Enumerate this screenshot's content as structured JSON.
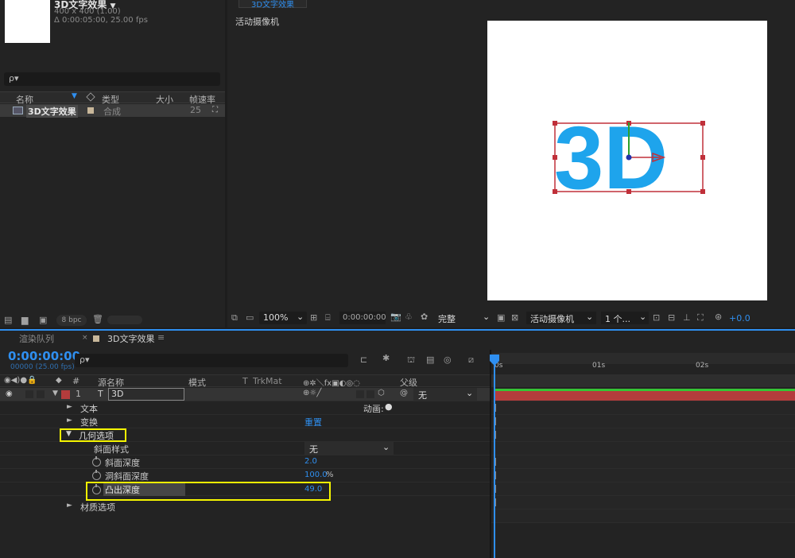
{
  "project": {
    "comp_name": "3D文字效果",
    "comp_size": "400 x 400 (1.00)",
    "comp_duration": "Δ 0:00:05:00, 25.00 fps",
    "search_placeholder": "ρ▾",
    "columns": {
      "name": "名称",
      "type": "类型",
      "size": "大小",
      "fps": "帧速率"
    },
    "items": [
      {
        "name": "3D文字效果",
        "type": "合成",
        "fps": "25"
      }
    ],
    "bpc": "8 bpc"
  },
  "viewer": {
    "tab": "3D文字效果",
    "camera_label": "活动摄像机",
    "zoom": "100%",
    "timecode": "0:00:00:00",
    "resolution": "完整",
    "view_camera": "活动摄像机",
    "views": "1 个...",
    "exposure": "+0.0",
    "text_3d": "3D"
  },
  "timeline": {
    "tabs": {
      "render": "渲染队列",
      "comp": "3D文字效果"
    },
    "timecode": "0:00:00:00",
    "frame_info": "00000 (25.00 fps)",
    "search_placeholder": "ρ▾",
    "headers": {
      "num": "#",
      "source": "源名称",
      "mode": "模式",
      "t": "T",
      "trkmat": "TrkMat",
      "parent": "父级"
    },
    "layer": {
      "index": "1",
      "type": "T",
      "name": "3D",
      "parent": "无"
    },
    "animate_label": "动画:",
    "props": {
      "text": "文本",
      "transform": "变换",
      "reset": "重置",
      "geometry": "几何选项",
      "bevel_style": "斜面样式",
      "bevel_style_value": "无",
      "bevel_depth": "斜面深度",
      "bevel_depth_value": "2.0",
      "hole_bevel_depth": "洞斜面深度",
      "hole_bevel_depth_value": "100.0",
      "hole_unit": "%",
      "extrusion_depth": "凸出深度",
      "extrusion_depth_value": "49.0",
      "material": "材质选项"
    },
    "ruler": [
      "0s",
      "01s",
      "02s"
    ]
  },
  "colors": {
    "accent": "#2f8ff0",
    "highlight": "#f5f500",
    "layer_bar": "#b43c3c",
    "text3d": "#1ea4ec",
    "bbox": "#c0303a"
  }
}
